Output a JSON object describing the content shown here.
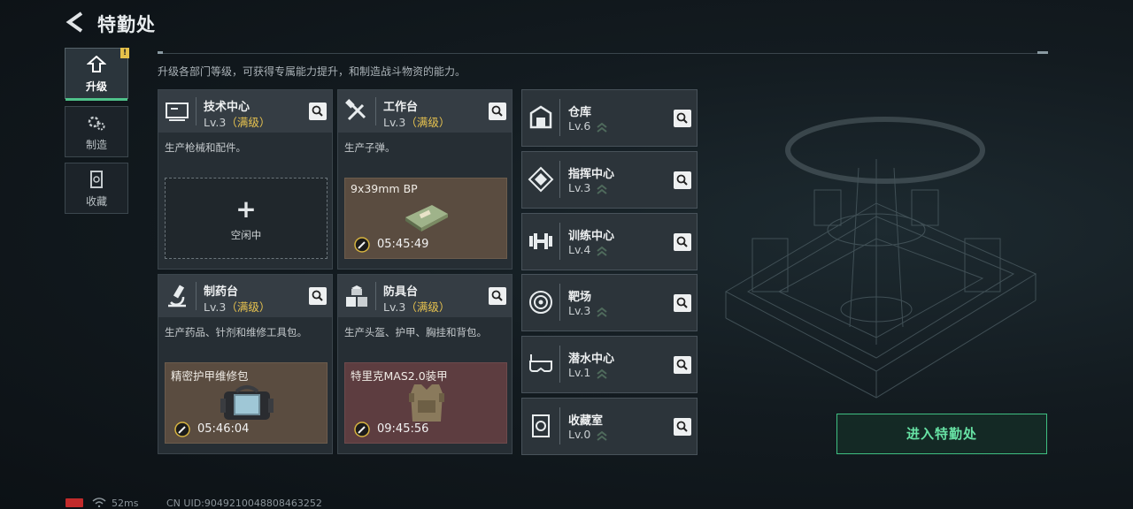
{
  "header": {
    "title": "特勤处",
    "description": "升级各部门等级，可获得专属能力提升，和制造战斗物资的能力。"
  },
  "tabs": [
    {
      "label": "升级",
      "icon": "upgrade-icon",
      "active": true,
      "badge": "!"
    },
    {
      "label": "制造",
      "icon": "gears-icon",
      "active": false
    },
    {
      "label": "收藏",
      "icon": "collection-icon",
      "active": false
    }
  ],
  "cards": [
    {
      "name": "技术中心",
      "level": "Lv.3",
      "max": "（满级）",
      "desc": "生产枪械和配件。",
      "icon": "computer-icon",
      "slot": {
        "state": "empty",
        "plus": "+",
        "idle": "空闲中"
      }
    },
    {
      "name": "工作台",
      "level": "Lv.3",
      "max": "（满级）",
      "desc": "生产子弹。",
      "icon": "tools-icon",
      "slot": {
        "state": "producing",
        "item": "9x39mm BP",
        "time": "05:45:49",
        "item_icon": "ammo-box-icon"
      }
    },
    {
      "name": "制药台",
      "level": "Lv.3",
      "max": "（满级）",
      "desc": "生产药品、针剂和维修工具包。",
      "icon": "microscope-icon",
      "slot": {
        "state": "producing",
        "item": "精密护甲维修包",
        "time": "05:46:04",
        "item_icon": "repair-kit-icon"
      }
    },
    {
      "name": "防具台",
      "level": "Lv.3",
      "max": "（满级）",
      "desc": "生产头盔、护甲、胸挂和背包。",
      "icon": "boxes-icon",
      "slot": {
        "state": "producing",
        "item": "特里克MAS2.0装甲",
        "time": "09:45:56",
        "item_icon": "body-armor-icon"
      }
    }
  ],
  "facilities": [
    {
      "name": "仓库",
      "level": "Lv.6",
      "icon": "warehouse-icon"
    },
    {
      "name": "指挥中心",
      "level": "Lv.3",
      "icon": "command-icon"
    },
    {
      "name": "训练中心",
      "level": "Lv.4",
      "icon": "dumbbell-icon"
    },
    {
      "name": "靶场",
      "level": "Lv.3",
      "icon": "target-icon"
    },
    {
      "name": "潜水中心",
      "level": "Lv.1",
      "icon": "diving-mask-icon"
    },
    {
      "name": "收藏室",
      "level": "Lv.0",
      "icon": "collection-room-icon"
    }
  ],
  "enter_button": "进入特勤处",
  "status": {
    "ping": "52ms",
    "uid": "CN UID:9049210048808463252"
  },
  "colors": {
    "accent_green": "#4fc28a",
    "max_level_yellow": "#e9c44f",
    "card_bg": "#262e34"
  }
}
